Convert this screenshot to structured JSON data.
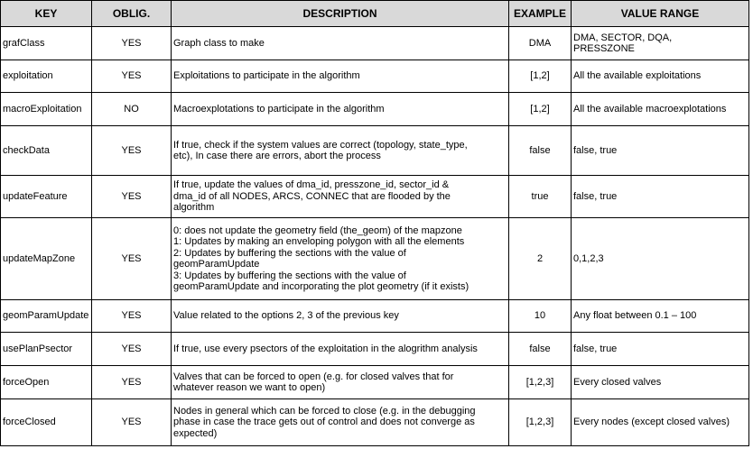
{
  "table": {
    "headers": [
      "KEY",
      "OBLIG.",
      "DESCRIPTION",
      "EXAMPLE",
      "VALUE RANGE"
    ],
    "rows": [
      {
        "key": "grafClass",
        "oblig": "YES",
        "description": "Graph class to make",
        "example": "DMA",
        "range": "DMA, SECTOR, DQA,\nPRESSZONE"
      },
      {
        "key": "exploitation",
        "oblig": "YES",
        "description": "Exploitations to participate in the algorithm",
        "example": "[1,2]",
        "range": "All the available exploitations"
      },
      {
        "key": "macroExploitation",
        "oblig": "NO",
        "description": "Macroexplotations to participate in the algorithm",
        "example": "[1,2]",
        "range": "All the available macroexplotations"
      },
      {
        "key": "checkData",
        "oblig": "YES",
        "description": "If true, check if the system values are correct (topology, state_type,\netc), In case there are errors, abort the process",
        "example": "false",
        "range": "false, true"
      },
      {
        "key": "updateFeature",
        "oblig": "YES",
        "description": " If true, update the values of dma_id, presszone_id, sector_id &\ndma_id of all NODES, ARCS, CONNEC that are flooded by the\nalgorithm",
        "example": "true",
        "range": "false, true"
      },
      {
        "key": "updateMapZone",
        "oblig": "YES",
        "description": "0: does not update the geometry field (the_geom) of the mapzone\n1: Updates by making an enveloping polygon with all the elements\n2: Updates by buffering the sections with the value of\ngeomParamUpdate\n3: Updates by buffering the sections with the value of\ngeomParamUpdate and incorporating the plot geometry (if it exists)",
        "example": "2",
        "range": "0,1,2,3"
      },
      {
        "key": "geomParamUpdate",
        "oblig": "YES",
        "description": "Value related to the options 2, 3 of the previous key",
        "example": "10",
        "range": "Any float between 0.1 – 100"
      },
      {
        "key": "usePlanPsector",
        "oblig": "YES",
        "description": "If true, use every psectors of the exploitation in the alogrithm analysis",
        "example": "false",
        "range": "false, true"
      },
      {
        "key": "forceOpen",
        "oblig": "YES",
        "description": "Valves that can be forced to open (e.g. for closed valves that for\nwhatever reason we want to open)",
        "example": "[1,2,3]",
        "range": "Every closed valves"
      },
      {
        "key": "forceClosed",
        "oblig": "YES",
        "description": "Nodes in general which can be forced to close (e.g. in the debugging\nphase in case the trace gets out of control and does not converge as\nexpected)",
        "example": "[1,2,3]",
        "range": "Every nodes (except closed valves)"
      }
    ]
  }
}
